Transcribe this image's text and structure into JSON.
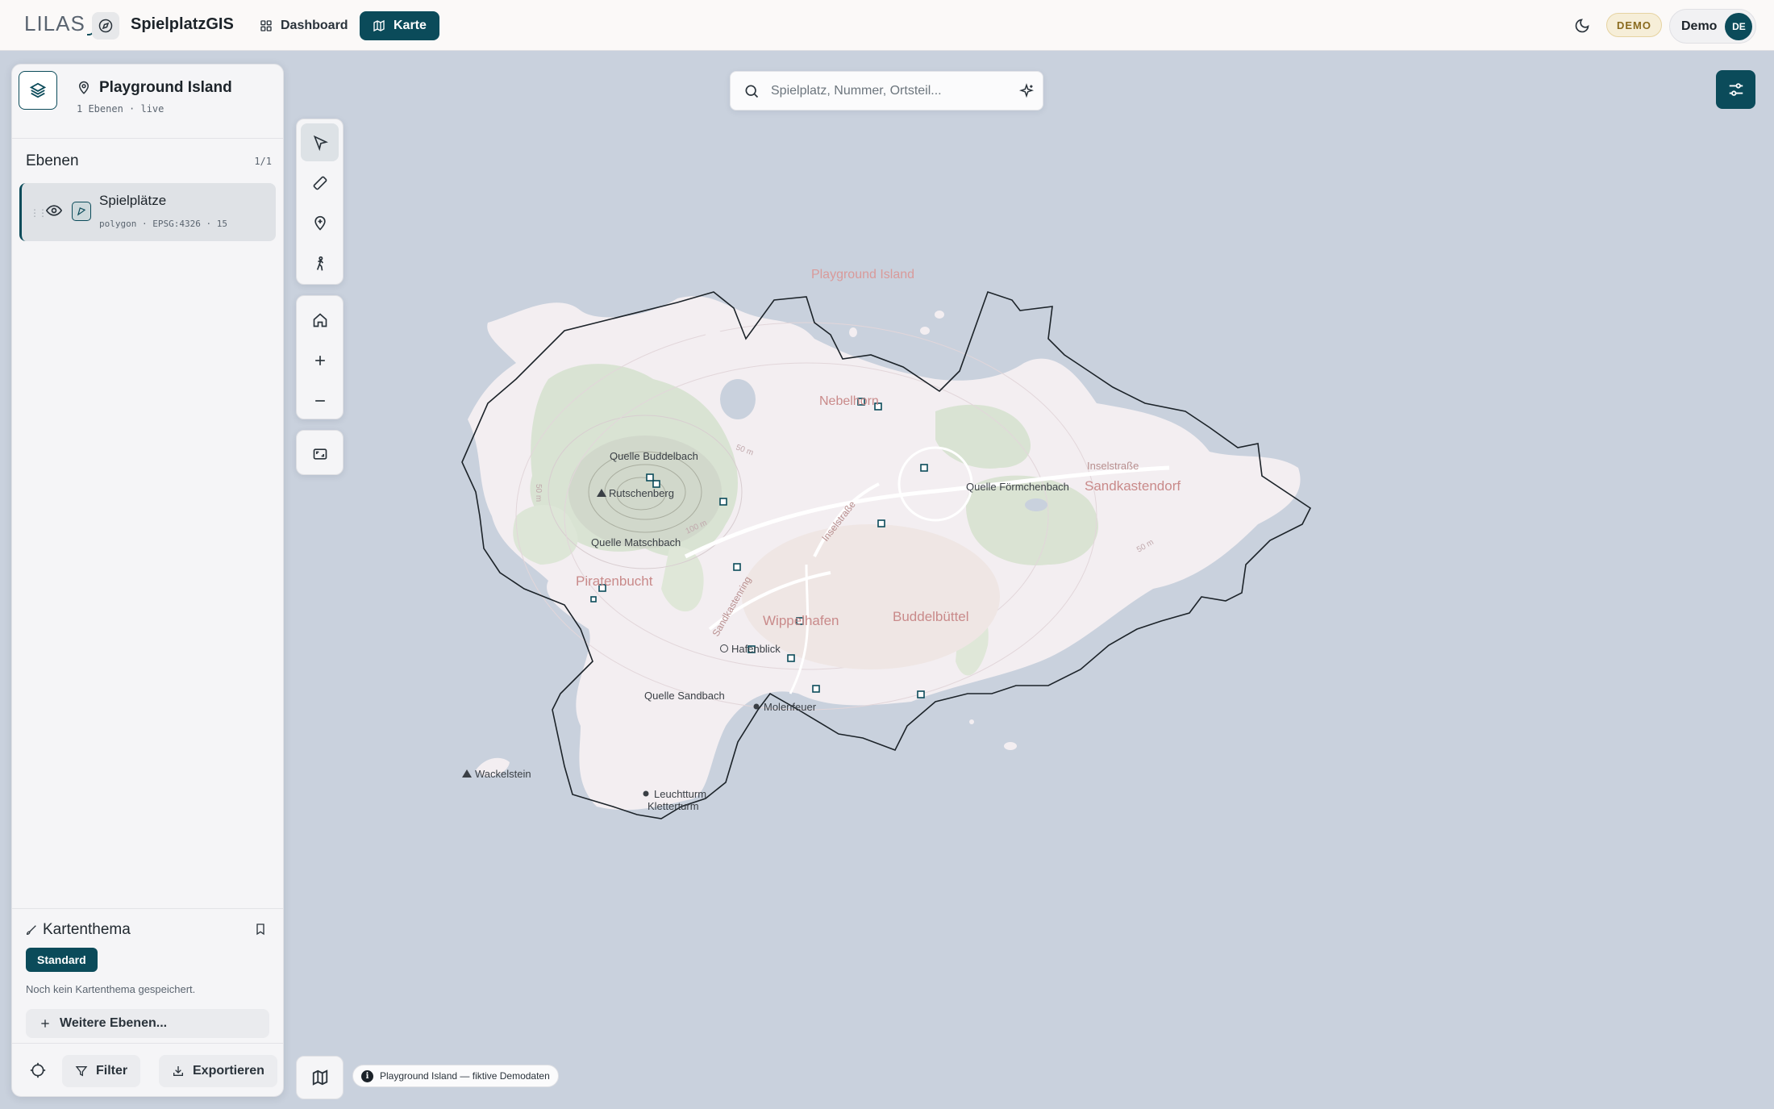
{
  "header": {
    "logo_text": "LILAS",
    "app_title": "SpielplatzGIS",
    "nav": [
      {
        "label": "Dashboard",
        "icon": "grid-icon"
      },
      {
        "label": "Karte",
        "icon": "map-icon",
        "active": true
      }
    ],
    "demo_badge": "DEMO",
    "user_name": "Demo",
    "user_initials": "DE"
  },
  "panel": {
    "project_title": "Playground Island",
    "project_sub": "1 Ebenen · live",
    "layers_heading": "Ebenen",
    "layers_count": "1/1",
    "layers": [
      {
        "name": "Spielplätze",
        "meta": "polygon · EPSG:4326 · 15",
        "visible": true
      }
    ],
    "theme_heading": "Kartenthema",
    "theme_chip": "Standard",
    "theme_note": "Noch kein Kartenthema gespeichert.",
    "more_layers": "Weitere Ebenen...",
    "filter_label": "Filter",
    "export_label": "Exportieren"
  },
  "search": {
    "placeholder": "Spielplatz, Nummer, Ortsteil..."
  },
  "map": {
    "island_name": "Playground Island",
    "places": [
      "Nebelhorn",
      "Sandkastendorf",
      "Piratenbucht",
      "Wippelhafen",
      "Buddelbüttel"
    ],
    "springs": [
      "Quelle Buddelbach",
      "Quelle Matschbach",
      "Quelle Förmchenbach",
      "Quelle Sandbach"
    ],
    "peaks": [
      "Rutschenberg",
      "Wackelstein"
    ],
    "pois": [
      "Hafenblick",
      "Molenfeuer",
      "Leuchtturm",
      "Kletterturm"
    ],
    "streets": [
      "Inselstraße",
      "Inselstraße",
      "Sandkastenring"
    ],
    "contours": [
      "50 m",
      "100 m",
      "50 m",
      "50 m"
    ],
    "colors": {
      "water": "#c9d1dd",
      "land": "#f3eef1",
      "forest": "#d6e2d0",
      "label_red": "#c98a8a",
      "accent": "#0b4b5a"
    }
  },
  "attribution": "Playground Island — fiktive Demodaten"
}
